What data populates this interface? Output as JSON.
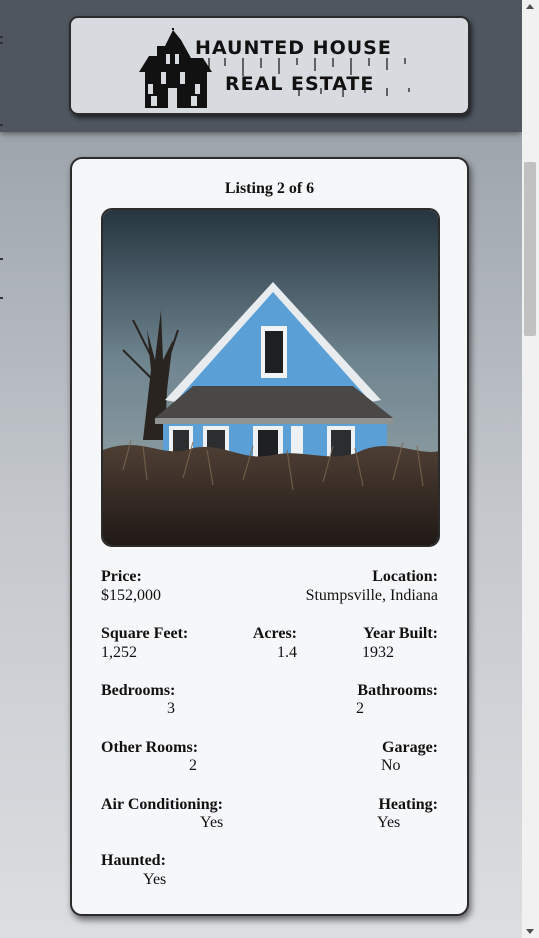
{
  "logo": {
    "line1": "HAUNTED HOUSE",
    "line2": "REAL ESTATE"
  },
  "listing": {
    "title": "Listing 2 of 6",
    "photo_alt": "Abandoned blue house in overgrown field",
    "fields": {
      "price": {
        "label": "Price:",
        "value": "$152,000"
      },
      "location": {
        "label": "Location:",
        "value": "Stumpsville, Indiana"
      },
      "square_feet": {
        "label": "Square Feet:",
        "value": "1,252"
      },
      "acres": {
        "label": "Acres:",
        "value": "1.4"
      },
      "year_built": {
        "label": "Year Built:",
        "value": "1932"
      },
      "bedrooms": {
        "label": "Bedrooms:",
        "value": "3"
      },
      "bathrooms": {
        "label": "Bathrooms:",
        "value": "2"
      },
      "other_rooms": {
        "label": "Other Rooms:",
        "value": "2"
      },
      "garage": {
        "label": "Garage:",
        "value": "No"
      },
      "air_conditioning": {
        "label": "Air Conditioning:",
        "value": "Yes"
      },
      "heating": {
        "label": "Heating:",
        "value": "Yes"
      },
      "haunted": {
        "label": "Haunted:",
        "value": "Yes"
      }
    }
  },
  "colors": {
    "header_band": "#4f5660",
    "card_bg": "#f6f7f9",
    "house_blue": "#5aa0d6"
  }
}
